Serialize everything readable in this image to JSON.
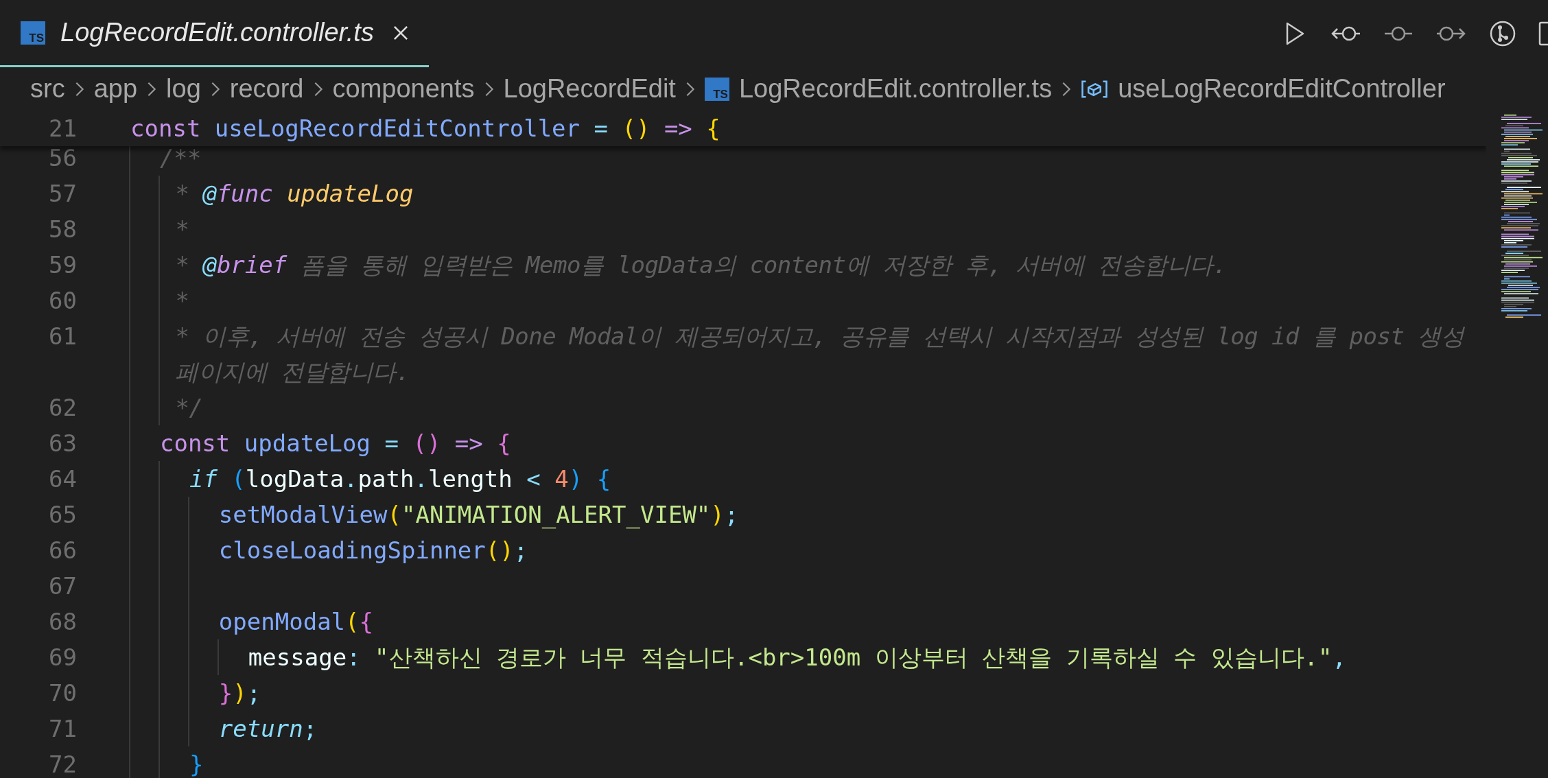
{
  "tabs": [
    {
      "label": "LogRecordEdit.controller.ts",
      "badge": "TS",
      "selected": true,
      "preview": true
    }
  ],
  "breadcrumbs": [
    {
      "kind": "folder",
      "label": "src"
    },
    {
      "kind": "folder",
      "label": "app"
    },
    {
      "kind": "folder",
      "label": "log"
    },
    {
      "kind": "folder",
      "label": "record"
    },
    {
      "kind": "folder",
      "label": "components"
    },
    {
      "kind": "folder",
      "label": "LogRecordEdit"
    },
    {
      "kind": "file",
      "label": "LogRecordEdit.controller.ts",
      "badge": "TS"
    },
    {
      "kind": "symbol",
      "label": "useLogRecordEditController"
    }
  ],
  "sticky_line": {
    "number": "21",
    "tokens": [
      {
        "text": "const ",
        "kind": "keyword"
      },
      {
        "text": "useLogRecordEditController",
        "kind": "fn"
      },
      {
        "text": " = ",
        "kind": "op"
      },
      {
        "text": "()",
        "kind": "b1"
      },
      {
        "text": " => ",
        "kind": "keyword"
      },
      {
        "text": "{",
        "kind": "b1"
      }
    ]
  },
  "lines": [
    {
      "number": "56",
      "tokens": [
        {
          "text": "  /**",
          "kind": "comment"
        }
      ]
    },
    {
      "number": "57",
      "tokens": [
        {
          "text": "   * ",
          "kind": "comment"
        },
        {
          "text": "@",
          "kind": "doc-at"
        },
        {
          "text": "func",
          "kind": "doc-tag"
        },
        {
          "text": " updateLog",
          "kind": "doc-name"
        }
      ]
    },
    {
      "number": "58",
      "tokens": [
        {
          "text": "   *",
          "kind": "comment"
        }
      ]
    },
    {
      "number": "59",
      "tokens": [
        {
          "text": "   * ",
          "kind": "comment"
        },
        {
          "text": "@",
          "kind": "doc-at"
        },
        {
          "text": "brief",
          "kind": "doc-tag"
        },
        {
          "text": " 폼을 통해 입력받은 Memo를 logData의 content에 저장한 후, 서버에 전송합니다.",
          "kind": "comment"
        }
      ]
    },
    {
      "number": "60",
      "tokens": [
        {
          "text": "   *",
          "kind": "comment"
        }
      ]
    },
    {
      "number": "61",
      "tokens": [
        {
          "text": "   * 이후, 서버에 전송 성공시 Done Modal이 제공되어지고, 공유를 선택시 시작지점과 성성된 log id 를 post 생성 페이지에 전달합니다.",
          "kind": "comment"
        }
      ]
    },
    {
      "number": "62",
      "tokens": [
        {
          "text": "   */",
          "kind": "comment"
        }
      ]
    },
    {
      "number": "63",
      "tokens": [
        {
          "text": "  const ",
          "kind": "keyword"
        },
        {
          "text": "updateLog",
          "kind": "fn"
        },
        {
          "text": " = ",
          "kind": "op"
        },
        {
          "text": "()",
          "kind": "b2"
        },
        {
          "text": " => ",
          "kind": "keyword"
        },
        {
          "text": "{",
          "kind": "b2"
        }
      ]
    },
    {
      "number": "64",
      "tokens": [
        {
          "text": "    if ",
          "kind": "control"
        },
        {
          "text": "(",
          "kind": "b3"
        },
        {
          "text": "logData",
          "kind": "plain"
        },
        {
          "text": ".",
          "kind": "op"
        },
        {
          "text": "path",
          "kind": "plain"
        },
        {
          "text": ".",
          "kind": "op"
        },
        {
          "text": "length",
          "kind": "plain"
        },
        {
          "text": " < ",
          "kind": "op"
        },
        {
          "text": "4",
          "kind": "num"
        },
        {
          "text": ") ",
          "kind": "b3"
        },
        {
          "text": "{",
          "kind": "b3"
        }
      ]
    },
    {
      "number": "65",
      "tokens": [
        {
          "text": "      setModalView",
          "kind": "fn"
        },
        {
          "text": "(",
          "kind": "b1"
        },
        {
          "text": "\"ANIMATION_ALERT_VIEW\"",
          "kind": "str"
        },
        {
          "text": ")",
          "kind": "b1"
        },
        {
          "text": ";",
          "kind": "punct"
        }
      ]
    },
    {
      "number": "66",
      "tokens": [
        {
          "text": "      closeLoadingSpinner",
          "kind": "fn"
        },
        {
          "text": "()",
          "kind": "b1"
        },
        {
          "text": ";",
          "kind": "punct"
        }
      ]
    },
    {
      "number": "67"
    },
    {
      "number": "68",
      "tokens": [
        {
          "text": "      openModal",
          "kind": "fn"
        },
        {
          "text": "(",
          "kind": "b1"
        },
        {
          "text": "{",
          "kind": "b2"
        }
      ]
    },
    {
      "number": "69",
      "tokens": [
        {
          "text": "        message",
          "kind": "plain"
        },
        {
          "text": ": ",
          "kind": "op"
        },
        {
          "text": "\"산책하신 경로가 너무 적습니다.<br>100m 이상부터 산책을 기록하실 수 있습니다.\"",
          "kind": "str"
        },
        {
          "text": ",",
          "kind": "punct"
        }
      ]
    },
    {
      "number": "70",
      "tokens": [
        {
          "text": "      }",
          "kind": "b2"
        },
        {
          "text": ")",
          "kind": "b1"
        },
        {
          "text": ";",
          "kind": "punct"
        }
      ]
    },
    {
      "number": "71",
      "tokens": [
        {
          "text": "      return",
          "kind": "control"
        },
        {
          "text": ";",
          "kind": "punct"
        }
      ]
    },
    {
      "number": "72",
      "tokens": [
        {
          "text": "    }",
          "kind": "b3"
        }
      ]
    }
  ]
}
